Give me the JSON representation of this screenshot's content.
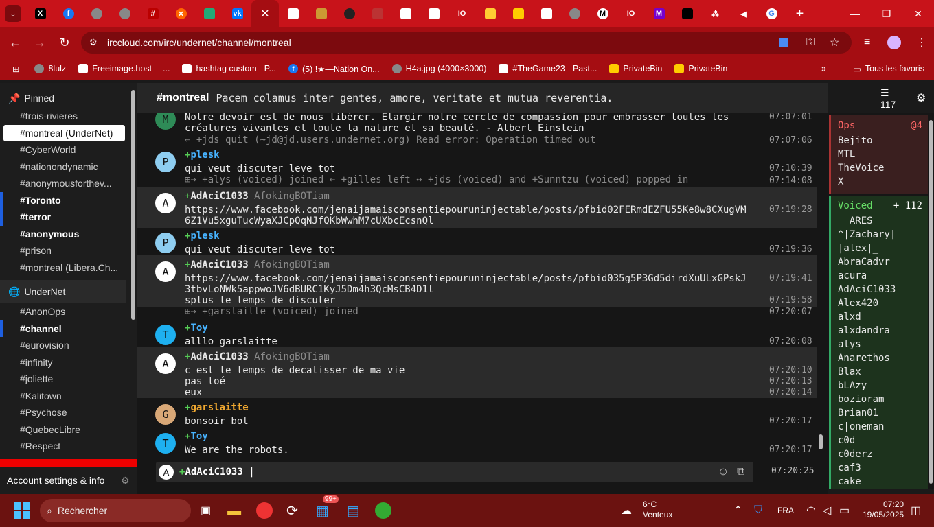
{
  "browser": {
    "active_tab_close": "✕",
    "url": "irccloud.com/irc/undernet/channel/montreal",
    "bookmarks": [
      "8lulz",
      "Freeimage.host —...",
      "hashtag custom - P...",
      "(5) !★—Nation On...",
      "H4a.jpg (4000×3000)",
      "#TheGame23 - Past...",
      "PrivateBin",
      "PrivateBin"
    ],
    "all_favorites": "Tous les favoris"
  },
  "sidebar": {
    "pinned_label": "Pinned",
    "pinned": [
      "#trois-rivieres",
      "#montreal (UnderNet)",
      "#CyberWorld",
      "#nationondynamic",
      "#anonymousforthev...",
      "#Toronto",
      "#terror",
      "#anonymous",
      "#prison",
      "#montreal (Libera.Ch..."
    ],
    "network_label": "UnderNet",
    "network_channels": [
      "#AnonOps",
      "#channel",
      "#eurovision",
      "#infinity",
      "#joliette",
      "#Kalitown",
      "#Psychose",
      "#QuebecLibre",
      "#Respect"
    ],
    "account": "Account settings & info"
  },
  "channel": {
    "name": "#montreal",
    "topic": "Pacem colamus inter gentes, amore, veritate et mutua reverentia.",
    "member_count": "117"
  },
  "messages": {
    "m1a": "Notre devoir est  de nous libérer. Elargir notre  cercle de compassion pour embrasser toutes les",
    "m1b": "créatures vivantes et toute  la nature et sa beauté. - Albert Einstein",
    "t1": "07:07:01",
    "m2": "⇐ +jds quit (~jd@jd.users.undernet.org) Read error: Operation timed out",
    "t2": "07:07:06",
    "n3": "plesk",
    "m3": "qui veut discuter leve tot",
    "t3": "07:10:39",
    "m4": "⊞→ +alys (voiced) joined  ← +gilles left  ↔ +jds (voiced) and +Sunntzu (voiced) popped in",
    "t4": "07:14:08",
    "n5": "AdAciC1033",
    "r5": "AfokingBOTiam",
    "m5a": "https://www.facebook.com/jenaijamaisconsentiepouruninjectable/posts/pfbid02FERmdEZFU55Ke8w8CXugVM",
    "m5b": "6Z1Vu5xguTucWyaXJCpQqNJfQKbWwhM7cUXbcEcsnQl",
    "t5": "07:19:28",
    "n6": "plesk",
    "m6": "qui veut discuter leve tot",
    "t6": "07:19:36",
    "n7": "AdAciC1033",
    "r7": "AfokingBOTiam",
    "m7a": "https://www.facebook.com/jenaijamaisconsentiepouruninjectable/posts/pfbid035g5P3Gd5dirdXuULxGPskJ",
    "m7b": "3tbvLoNWk5appwoJV6dBURC1KyJ5Dm4h3QcMsCB4D1l",
    "t7": "07:19:41",
    "m7c": "splus le temps de discuter",
    "t7c": "07:19:58",
    "m8": "⊞→ +garslaitte (voiced) joined",
    "t8": "07:20:07",
    "n9": "Toy",
    "m9": "alllo garslaitte",
    "t9": "07:20:08",
    "n10": "AdAciC1033",
    "r10": "AfokingBOTiam",
    "m10a": "c est le temps de decalisser de ma vie",
    "t10a": "07:20:10",
    "m10b": "pas toé",
    "t10b": "07:20:13",
    "m10c": "eux",
    "t10c": "07:20:14",
    "n11": "garslaitte",
    "m11": "bonsoir bot",
    "t11": "07:20:17",
    "n12": "Toy",
    "m12": "We are the robots.",
    "t12": "07:20:17"
  },
  "input": {
    "nick": "AdAciC1033",
    "time": "07:20:25"
  },
  "members": {
    "ops_label": "Ops",
    "ops_count": "4",
    "ops": [
      "Bejito",
      "MTL",
      "TheVoice",
      "X"
    ],
    "voiced_label": "Voiced",
    "voiced_count": "112",
    "voiced": [
      "__ARES__",
      "^|Zachary|",
      "|alex|_",
      "AbraCadvr",
      "acura",
      "AdAciC1033",
      "Alex420",
      "alxd",
      "alxdandra",
      "alys",
      "Anarethos",
      "Blax",
      "bLAzy",
      "bozioram",
      "Brian01",
      "c|oneman_",
      "c0d",
      "c0derz",
      "caf3",
      "cake"
    ]
  },
  "taskbar": {
    "search": "Rechercher",
    "badge": "99+",
    "weather_temp": "6°C",
    "weather_desc": "Venteux",
    "lang": "FRA",
    "time": "07:20",
    "date": "19/05/2025"
  }
}
